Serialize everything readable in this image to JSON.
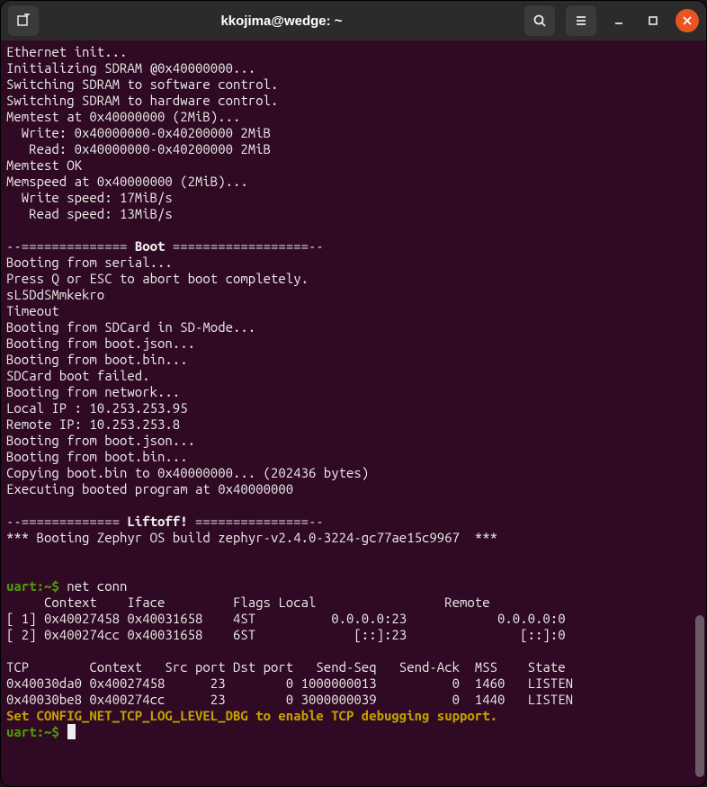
{
  "window": {
    "title": "kkojima@wedge: ~"
  },
  "terminal": {
    "boot_lines": [
      "Ethernet init...",
      "Initializing SDRAM @0x40000000...",
      "Switching SDRAM to software control.",
      "Switching SDRAM to hardware control.",
      "Memtest at 0x40000000 (2MiB)...",
      "  Write: 0x40000000-0x40200000 2MiB",
      "   Read: 0x40000000-0x40200000 2MiB",
      "Memtest OK",
      "Memspeed at 0x40000000 (2MiB)...",
      "  Write speed: 17MiB/s",
      "   Read speed: 13MiB/s",
      ""
    ],
    "boot_header_prefix": "--============== ",
    "boot_header_word": "Boot",
    "boot_header_suffix": " ==================--",
    "boot2_lines": [
      "Booting from serial...",
      "Press Q or ESC to abort boot completely.",
      "sL5DdSMmkekro",
      "Timeout",
      "Booting from SDCard in SD-Mode...",
      "Booting from boot.json...",
      "Booting from boot.bin...",
      "SDCard boot failed.",
      "Booting from network...",
      "Local IP : 10.253.253.95",
      "Remote IP: 10.253.253.8",
      "Booting from boot.json...",
      "Booting from boot.bin...",
      "Copying boot.bin to 0x40000000... (202436 bytes)",
      "Executing booted program at 0x40000000",
      ""
    ],
    "liftoff_header_prefix": "--============= ",
    "liftoff_header_word": "Liftoff!",
    "liftoff_header_suffix": " ===============--",
    "zephyr_line": "*** Booting Zephyr OS build zephyr-v2.4.0-3224-gc77ae15c9967  ***",
    "blank": "",
    "prompt": "uart:~$ ",
    "cmd": "net conn",
    "conn_header": "     Context    Iface         Flags Local           \t  Remote",
    "conn_rows": [
      "[ 1] 0x40027458 0x40031658    4ST          0.0.0.0:23\t         0.0.0.0:0",
      "[ 2] 0x400274cc 0x40031658    6ST             [::]:23\t            [::]:0"
    ],
    "tcp_header": "TCP        Context   Src port Dst port   Send-Seq   Send-Ack  MSS    State",
    "tcp_rows": [
      "0x40030da0 0x40027458      23        0 1000000013          0  1460   LISTEN",
      "0x40030be8 0x400274cc      23        0 3000000039          0  1440   LISTEN"
    ],
    "warn_line": "Set CONFIG_NET_TCP_LOG_LEVEL_DBG to enable TCP debugging support."
  }
}
